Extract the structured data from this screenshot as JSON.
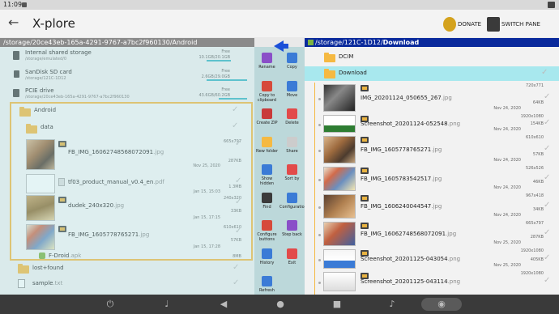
{
  "status": {
    "time": "11:09"
  },
  "app": {
    "title": "X-plore",
    "donate": "DONATE",
    "switch_pane": "SWITCH PANE"
  },
  "left": {
    "path": "/storage/20ce43eb-165a-4291-9767-a7bc2f960130/Android",
    "internal": {
      "name": "Internal shared storage",
      "sub": "/storage/emulated/0",
      "free": "Free",
      "size": "10.1GB/20.1GB"
    },
    "sdcard": {
      "name": "SanDisk SD card",
      "sub": "/storage/121C-1D12",
      "free": "Free",
      "size": "2.6GB/29.0GB"
    },
    "pcie": {
      "name": "PCIE drive",
      "sub": "/storage/20ce43eb-165a-4291-9767-a7bc2f960130",
      "free": "Free",
      "size": "43.6GB/60.2GB"
    },
    "android_folder": "Android",
    "data_folder": "data",
    "files": [
      {
        "name": "FB_IMG_16062748568072091",
        "ext": ".jpg",
        "dim": "665x797",
        "size": "287KB",
        "date": "Nov 25, 2020"
      },
      {
        "name": "tf03_product_manual_v0.4_en",
        "ext": ".pdf",
        "dim": "",
        "size": "1.3MB",
        "date": "Jan 15, 15:03"
      },
      {
        "name": "dudek_240x320",
        "ext": ".jpg",
        "dim": "240x320",
        "size": "33KB",
        "date": "Jan 15, 17:15"
      },
      {
        "name": "FB_IMG_1605778765271",
        "ext": ".jpg",
        "dim": "610x610",
        "size": "57KB",
        "date": "Jan 15, 17:28"
      }
    ],
    "fdroid": {
      "name": "F-Droid",
      "ext": ".apk",
      "size": "8MB"
    },
    "lostfound": "lost+found",
    "sample": {
      "name": "sample",
      "ext": ".txt"
    }
  },
  "tools": [
    {
      "label": "Rename",
      "color": "#8a4fc8"
    },
    {
      "label": "Copy",
      "color": "#3b7bd6"
    },
    {
      "label": "Copy to clipboard",
      "color": "#d64a3b"
    },
    {
      "label": "Move",
      "color": "#3b7bd6"
    },
    {
      "label": "Create ZIP",
      "color": "#c93a3a"
    },
    {
      "label": "Delete",
      "color": "#e24a4a"
    },
    {
      "label": "New folder",
      "color": "#f5b942"
    },
    {
      "label": "Share",
      "color": "#ccc"
    },
    {
      "label": "Show hidden",
      "color": "#3b7bd6"
    },
    {
      "label": "Sort by",
      "color": "#e24a4a"
    },
    {
      "label": "Find",
      "color": "#3b3b3b"
    },
    {
      "label": "Configuration",
      "color": "#3b7bd6"
    },
    {
      "label": "Configure buttons",
      "color": "#d64a3b"
    },
    {
      "label": "Step back",
      "color": "#8a4fc8"
    },
    {
      "label": "History",
      "color": "#3b7bd6"
    },
    {
      "label": "Exit",
      "color": "#e24a4a"
    },
    {
      "label": "Refresh",
      "color": "#3b7bd6"
    }
  ],
  "right": {
    "path_prefix": "/storage/121C-1D12/",
    "path_current": "Download",
    "dcim": "DCIM",
    "download": "Download",
    "files": [
      {
        "name": "IMG_20201124_050655_267",
        "ext": ".jpg",
        "dim": "720x771",
        "size": "64KB",
        "date": "Nov 24, 2020"
      },
      {
        "name": "Screenshot_20201124-052548",
        "ext": ".png",
        "dim": "1920x1080",
        "size": "154KB",
        "date": "Nov 24, 2020"
      },
      {
        "name": "FB_IMG_1605778765271",
        "ext": ".jpg",
        "dim": "610x610",
        "size": "57KB",
        "date": "Nov 24, 2020"
      },
      {
        "name": "FB_IMG_1605783542517",
        "ext": ".jpg",
        "dim": "526x526",
        "size": "46KB",
        "date": "Nov 24, 2020"
      },
      {
        "name": "FB_IMG_1606240044547",
        "ext": ".jpg",
        "dim": "967x418",
        "size": "34KB",
        "date": "Nov 24, 2020"
      },
      {
        "name": "FB_IMG_16062748568072091",
        "ext": ".jpg",
        "dim": "665x797",
        "size": "287KB",
        "date": "Nov 25, 2020"
      },
      {
        "name": "Screenshot_20201125-043054",
        "ext": ".png",
        "dim": "1920x1080",
        "size": "405KB",
        "date": "Nov 25, 2020"
      },
      {
        "name": "Screenshot_20201125-043114",
        "ext": ".png",
        "dim": "1920x1080",
        "size": "",
        "date": ""
      }
    ]
  },
  "colors": {
    "accent": "#3ab6c4",
    "path_right_bg": "#0a2a9c",
    "highlight": "#a8e8ee"
  }
}
